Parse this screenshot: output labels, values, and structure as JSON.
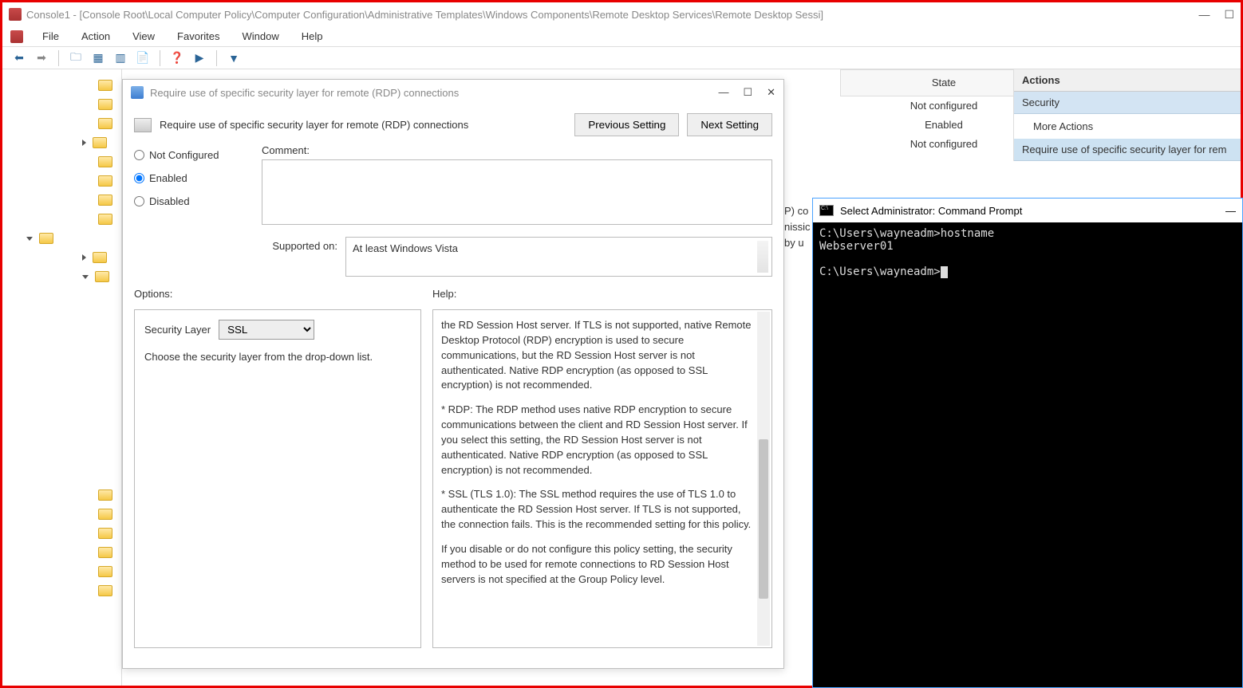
{
  "titlebar": {
    "text": "Console1 - [Console Root\\Local Computer Policy\\Computer Configuration\\Administrative Templates\\Windows Components\\Remote Desktop Services\\Remote Desktop Sessi]"
  },
  "menu": {
    "file": "File",
    "action": "Action",
    "view": "View",
    "favorites": "Favorites",
    "window": "Window",
    "help": "Help"
  },
  "statecol": {
    "header": "State",
    "rows": [
      "Not configured",
      "Enabled",
      "Not configured"
    ]
  },
  "peek": {
    "line1": "P) co",
    "line2": "nissic",
    "line3": "by u"
  },
  "actions": {
    "header": "Actions",
    "section1": "Security",
    "more1": "More Actions",
    "section2": "Require use of specific security layer for rem"
  },
  "dialog": {
    "wintitle": "Require use of specific security layer for remote (RDP) connections",
    "headtitle": "Require use of specific security layer for remote (RDP) connections",
    "prev": "Previous Setting",
    "next": "Next Setting",
    "radio_nc": "Not Configured",
    "radio_en": "Enabled",
    "radio_dis": "Disabled",
    "comment_label": "Comment:",
    "supported_label": "Supported on:",
    "supported_text": "At least Windows Vista",
    "options_label": "Options:",
    "help_label": "Help:",
    "sec_layer_label": "Security Layer",
    "sec_layer_value": "SSL",
    "opt_hint": "Choose the security layer from the drop-down list.",
    "help_p1": "the RD Session Host server. If TLS is not supported, native Remote Desktop Protocol (RDP) encryption is used to secure communications, but the RD Session Host server is not authenticated. Native RDP encryption (as opposed to SSL encryption) is not recommended.",
    "help_p2": "* RDP: The RDP method uses native RDP encryption to secure communications between the client and RD Session Host server. If you select this setting, the RD Session Host server is not authenticated. Native RDP encryption (as opposed to SSL encryption) is not recommended.",
    "help_p3": "* SSL (TLS 1.0): The SSL method requires the use of TLS 1.0 to authenticate the RD Session Host server. If TLS is not supported, the connection fails. This is the recommended setting for this policy.",
    "help_p4": "If you disable or do not configure this policy setting, the security method to be used for remote connections to RD Session Host servers is not specified at the Group Policy level."
  },
  "cmd": {
    "title": "Select Administrator: Command Prompt",
    "line1": "C:\\Users\\wayneadm>hostname",
    "line2": "Webserver01",
    "line3": "C:\\Users\\wayneadm>"
  }
}
